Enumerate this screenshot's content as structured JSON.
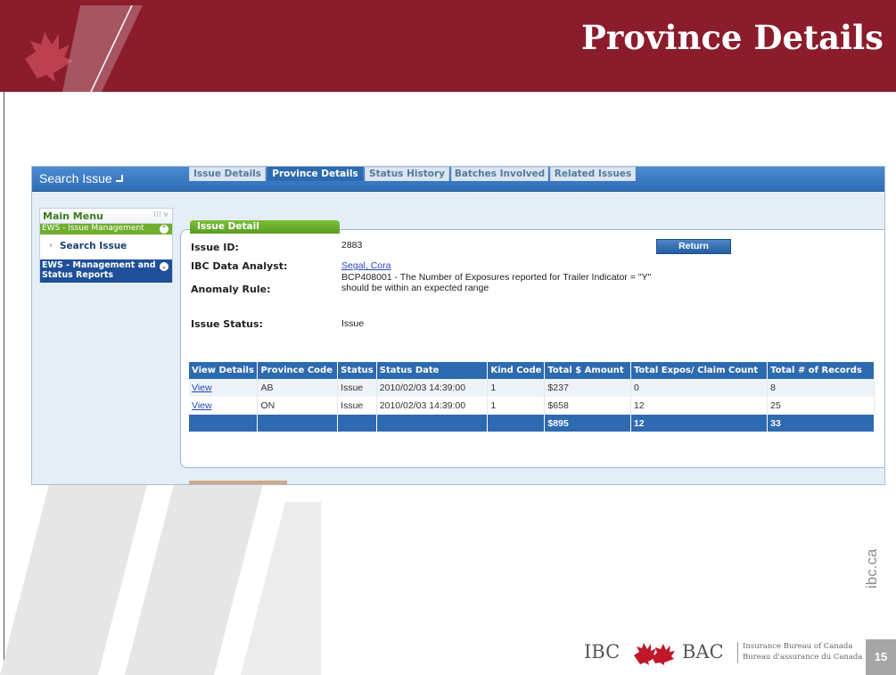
{
  "slide": {
    "title": "Province Details",
    "page_number": "15",
    "side_url": "ibc.ca",
    "colors": {
      "header_bg": "#8a1c2b",
      "app_blue": "#2d6ab0",
      "menu_green": "#6fae2e"
    }
  },
  "app": {
    "title": "Search Issue",
    "menu": {
      "header": "Main Menu",
      "section1": "EWS - Issue Management",
      "item": "Search Issue",
      "section2": "EWS - Management and Status Reports"
    },
    "issue_detail": {
      "tab_label": "Issue Detail",
      "labels": {
        "issue_id": "Issue ID:",
        "analyst": "IBC Data Analyst:",
        "anomaly_rule": "Anomaly Rule:",
        "issue_status": "Issue Status:"
      },
      "values": {
        "issue_id": "2883",
        "analyst": "Segal, Cora",
        "anomaly_rule_line1": "BCP408001 - The Number of Exposures reported for Trailer Indicator = \"Y\"",
        "anomaly_rule_line2": "should be within an expected range",
        "issue_status": "Issue"
      },
      "return_button": "Return"
    },
    "tabs": [
      "Issue Details",
      "Province Details",
      "Status History",
      "Batches Involved",
      "Related Issues"
    ],
    "active_tab": "Province Details",
    "table": {
      "headers": [
        "View Details",
        "Province Code",
        "Status",
        "Status Date",
        "Kind Code",
        "Total $ Amount",
        "Total Expos/ Claim Count",
        "Total # of Records"
      ],
      "rows": [
        [
          "View",
          "AB",
          "Issue",
          "2010/02/03 14:39:00",
          "1",
          "$237",
          "0",
          "8"
        ],
        [
          "View",
          "ON",
          "Issue",
          "2010/02/03 14:39:00",
          "1",
          "$658",
          "12",
          "25"
        ]
      ],
      "totals": [
        "",
        "",
        "",
        "",
        "",
        "$895",
        "12",
        "33"
      ]
    }
  },
  "footer": {
    "ibc": "IBC",
    "bac": "BAC",
    "org_en": "Insurance Bureau of Canada",
    "org_fr": "Bureau d'assurance du Canada"
  }
}
